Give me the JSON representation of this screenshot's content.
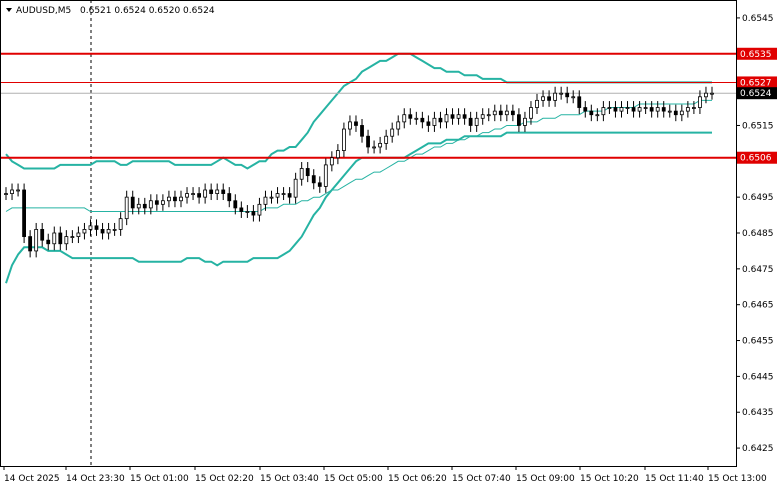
{
  "header": {
    "symbol": "AUDUSD,M5",
    "ohlc": "0.6521 0.6524 0.6520 0.6524",
    "menu_icon": "triangle-down-icon"
  },
  "colors": {
    "background": "#ffffff",
    "frame": "#000000",
    "candle": "#000000",
    "band": "#26b3a3",
    "level": "#e00000",
    "price_line": "#b0b0b0",
    "tag_text": "#ffffff",
    "price_tag_bg": "#000000"
  },
  "chart_data": {
    "type": "candlestick",
    "symbol": "AUDUSD",
    "timeframe": "M5",
    "title": "AUDUSD,M5",
    "ylim": [
      0.642,
      0.655
    ],
    "y_ticks": [
      "0.6545",
      "0.6535",
      "0.6527",
      "0.6524",
      "0.6515",
      "0.6506",
      "0.6495",
      "0.6485",
      "0.6475",
      "0.6465",
      "0.6455",
      "0.6445",
      "0.6435",
      "0.6425"
    ],
    "x_ticks": [
      "14 Oct 2025",
      "14 Oct 23:30",
      "15 Oct 01:00",
      "15 Oct 02:20",
      "15 Oct 03:40",
      "15 Oct 05:00",
      "15 Oct 06:20",
      "15 Oct 07:40",
      "15 Oct 09:00",
      "15 Oct 10:20",
      "15 Oct 11:40",
      "15 Oct 13:00"
    ],
    "horizontal_levels": [
      {
        "label": "0.6535",
        "value": 0.6535
      },
      {
        "label": "0.6527",
        "value": 0.6527
      },
      {
        "label": "0.6506",
        "value": 0.6506
      }
    ],
    "current_price": {
      "label": "0.6524",
      "value": 0.6524
    },
    "vertical_marker": "14 Oct 23:30",
    "closes": [
      0.6496,
      0.6497,
      0.6497,
      0.6484,
      0.648,
      0.6486,
      0.6483,
      0.6482,
      0.6485,
      0.6482,
      0.6484,
      0.6484,
      0.6485,
      0.6486,
      0.6487,
      0.6486,
      0.6485,
      0.6486,
      0.6486,
      0.6489,
      0.6495,
      0.6492,
      0.6493,
      0.6492,
      0.6494,
      0.6493,
      0.6494,
      0.6495,
      0.6494,
      0.6495,
      0.6496,
      0.6496,
      0.6495,
      0.6497,
      0.6496,
      0.6497,
      0.6496,
      0.6494,
      0.6492,
      0.6491,
      0.6491,
      0.649,
      0.6493,
      0.6495,
      0.6495,
      0.6496,
      0.6496,
      0.6495,
      0.65,
      0.6503,
      0.6501,
      0.6499,
      0.6498,
      0.6504,
      0.6506,
      0.6508,
      0.6514,
      0.6516,
      0.6515,
      0.6512,
      0.6509,
      0.6509,
      0.651,
      0.6512,
      0.6514,
      0.6516,
      0.6518,
      0.6517,
      0.6517,
      0.6516,
      0.6515,
      0.6517,
      0.6516,
      0.6518,
      0.6517,
      0.6518,
      0.6517,
      0.6515,
      0.6517,
      0.6518,
      0.6518,
      0.6519,
      0.6518,
      0.6519,
      0.6518,
      0.6515,
      0.6517,
      0.652,
      0.6522,
      0.6523,
      0.6522,
      0.6524,
      0.6524,
      0.6523,
      0.6523,
      0.652,
      0.6519,
      0.6518,
      0.6518,
      0.652,
      0.652,
      0.6519,
      0.652,
      0.652,
      0.6519,
      0.652,
      0.652,
      0.6519,
      0.652,
      0.6519,
      0.6519,
      0.6518,
      0.6519,
      0.652,
      0.652,
      0.6523,
      0.6524,
      0.6524
    ],
    "bands": {
      "upper": [
        0.6507,
        0.6505,
        0.6504,
        0.6503,
        0.6503,
        0.6503,
        0.6503,
        0.6503,
        0.6503,
        0.6504,
        0.6504,
        0.6504,
        0.6504,
        0.6504,
        0.6504,
        0.6505,
        0.6505,
        0.6505,
        0.6505,
        0.6504,
        0.6504,
        0.6505,
        0.6505,
        0.6505,
        0.6505,
        0.6505,
        0.6505,
        0.6505,
        0.6504,
        0.6504,
        0.6504,
        0.6504,
        0.6504,
        0.6504,
        0.6504,
        0.6505,
        0.6506,
        0.6505,
        0.6504,
        0.6504,
        0.6503,
        0.6504,
        0.6505,
        0.6505,
        0.6507,
        0.6508,
        0.6508,
        0.6509,
        0.6509,
        0.6511,
        0.6513,
        0.6516,
        0.6518,
        0.652,
        0.6522,
        0.6524,
        0.6526,
        0.6527,
        0.6528,
        0.653,
        0.6531,
        0.6532,
        0.6533,
        0.6533,
        0.6534,
        0.6535,
        0.6535,
        0.6535,
        0.6534,
        0.6533,
        0.6532,
        0.6531,
        0.6531,
        0.653,
        0.653,
        0.653,
        0.6529,
        0.6529,
        0.6529,
        0.6528,
        0.6528,
        0.6528,
        0.6528,
        0.6527,
        0.6527,
        0.6527,
        0.6527,
        0.6527,
        0.6527,
        0.6527,
        0.6527,
        0.6527,
        0.6527,
        0.6527,
        0.6527,
        0.6527,
        0.6527,
        0.6527,
        0.6527,
        0.6527,
        0.6527,
        0.6527,
        0.6527,
        0.6527,
        0.6527,
        0.6527,
        0.6527,
        0.6527,
        0.6527,
        0.6527,
        0.6527,
        0.6527,
        0.6527,
        0.6527,
        0.6527,
        0.6527,
        0.6527,
        0.6527
      ],
      "middle": [
        0.6491,
        0.6492,
        0.6492,
        0.6492,
        0.6492,
        0.6492,
        0.6492,
        0.6492,
        0.6492,
        0.6492,
        0.6492,
        0.6492,
        0.6492,
        0.6492,
        0.6491,
        0.6491,
        0.6491,
        0.6491,
        0.6491,
        0.6491,
        0.6491,
        0.6491,
        0.6491,
        0.6491,
        0.6491,
        0.6491,
        0.6491,
        0.6491,
        0.6491,
        0.6491,
        0.6491,
        0.6491,
        0.6491,
        0.6491,
        0.6491,
        0.6491,
        0.6491,
        0.6491,
        0.6491,
        0.6491,
        0.6491,
        0.6491,
        0.6491,
        0.6492,
        0.6492,
        0.6492,
        0.6493,
        0.6493,
        0.6493,
        0.6494,
        0.6494,
        0.6495,
        0.6495,
        0.6496,
        0.6497,
        0.6497,
        0.6498,
        0.6499,
        0.65,
        0.65,
        0.6501,
        0.6502,
        0.6502,
        0.6503,
        0.6504,
        0.6505,
        0.6505,
        0.6506,
        0.6507,
        0.6507,
        0.6508,
        0.6509,
        0.6509,
        0.651,
        0.651,
        0.6511,
        0.6511,
        0.6512,
        0.6512,
        0.6513,
        0.6513,
        0.6514,
        0.6514,
        0.6515,
        0.6515,
        0.6515,
        0.6516,
        0.6516,
        0.6516,
        0.6517,
        0.6517,
        0.6517,
        0.6518,
        0.6518,
        0.6518,
        0.6518,
        0.6519,
        0.6519,
        0.6519,
        0.6519,
        0.652,
        0.652,
        0.652,
        0.652,
        0.652,
        0.6521,
        0.6521,
        0.6521,
        0.6521,
        0.6521,
        0.6521,
        0.6521,
        0.6521,
        0.6521,
        0.6521,
        0.6522,
        0.6522,
        0.6522
      ],
      "lower": [
        0.6471,
        0.6476,
        0.6479,
        0.6481,
        0.6481,
        0.6481,
        0.6481,
        0.648,
        0.648,
        0.648,
        0.6479,
        0.6478,
        0.6478,
        0.6478,
        0.6478,
        0.6478,
        0.6478,
        0.6478,
        0.6478,
        0.6478,
        0.6478,
        0.6478,
        0.6477,
        0.6477,
        0.6477,
        0.6477,
        0.6477,
        0.6477,
        0.6477,
        0.6477,
        0.6478,
        0.6478,
        0.6478,
        0.6477,
        0.6477,
        0.6476,
        0.6477,
        0.6477,
        0.6477,
        0.6477,
        0.6477,
        0.6478,
        0.6478,
        0.6478,
        0.6478,
        0.6478,
        0.6479,
        0.648,
        0.6482,
        0.6484,
        0.6487,
        0.649,
        0.6492,
        0.6495,
        0.6497,
        0.6499,
        0.6501,
        0.6503,
        0.6505,
        0.6506,
        0.6506,
        0.6506,
        0.6506,
        0.6506,
        0.6506,
        0.6506,
        0.6506,
        0.6507,
        0.6508,
        0.6509,
        0.651,
        0.651,
        0.651,
        0.6511,
        0.6511,
        0.6511,
        0.6512,
        0.6512,
        0.6512,
        0.6512,
        0.6512,
        0.6512,
        0.6512,
        0.6513,
        0.6513,
        0.6513,
        0.6513,
        0.6513,
        0.6513,
        0.6513,
        0.6513,
        0.6513,
        0.6513,
        0.6513,
        0.6513,
        0.6513,
        0.6513,
        0.6513,
        0.6513,
        0.6513,
        0.6513,
        0.6513,
        0.6513,
        0.6513,
        0.6513,
        0.6513,
        0.6513,
        0.6513,
        0.6513,
        0.6513,
        0.6513,
        0.6513,
        0.6513,
        0.6513,
        0.6513,
        0.6513,
        0.6513,
        0.6513
      ]
    }
  }
}
